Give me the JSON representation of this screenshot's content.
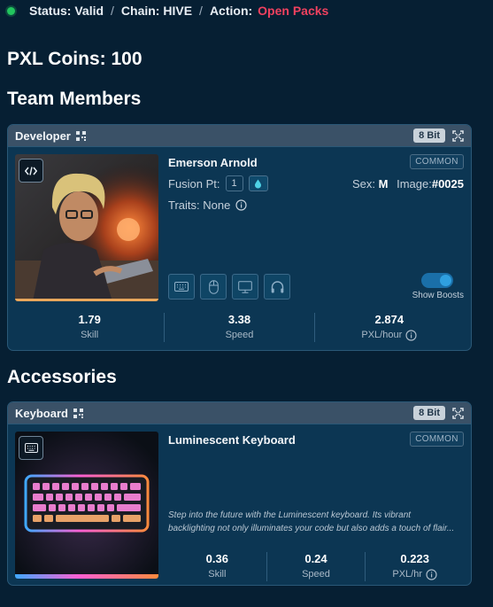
{
  "status": {
    "status_text": "Status: Valid",
    "chain_text": "Chain: HIVE",
    "action_prefix": "Action:",
    "action_link": "Open Packs",
    "separator": "/"
  },
  "coins": {
    "label": "PXL Coins: 100"
  },
  "sections": {
    "team": "Team Members",
    "accessories": "Accessories"
  },
  "team_card": {
    "header": "Developer",
    "bit_badge": "8 Bit",
    "name": "Emerson Arnold",
    "rarity": "COMMON",
    "fusion_label": "Fusion Pt:",
    "fusion_value": "1",
    "sex_label": "Sex:",
    "sex_value": "M",
    "image_label": "Image:",
    "image_value": "#0025",
    "traits": "Traits: None",
    "boosts_label": "Show Boosts",
    "stats": [
      {
        "value": "1.79",
        "label": "Skill"
      },
      {
        "value": "3.38",
        "label": "Speed"
      },
      {
        "value": "2.874",
        "label": "PXL/hour"
      }
    ]
  },
  "accessory_card": {
    "header": "Keyboard",
    "bit_badge": "8 Bit",
    "name": "Luminescent Keyboard",
    "rarity": "COMMON",
    "description_line1": "Step into the future with the Luminescent keyboard. Its vibrant",
    "description_line2": "backlighting not only illuminates your code but also adds a touch of flair...",
    "stats": [
      {
        "value": "0.36",
        "label": "Skill"
      },
      {
        "value": "0.24",
        "label": "Speed"
      },
      {
        "value": "0.223",
        "label": "PXL/hr"
      }
    ]
  },
  "icons": [
    "qr-icon",
    "expand-icon",
    "code-icon",
    "water-drop-icon",
    "info-icon",
    "keyboard-icon",
    "mouse-icon",
    "monitor-icon",
    "headphones-icon"
  ],
  "colors": {
    "background": "#061f33",
    "card": "#0c3653",
    "header": "#3a5167",
    "accent_red": "#f0415f",
    "status_green": "#22c55e",
    "toggle": "#1a6fa8"
  }
}
